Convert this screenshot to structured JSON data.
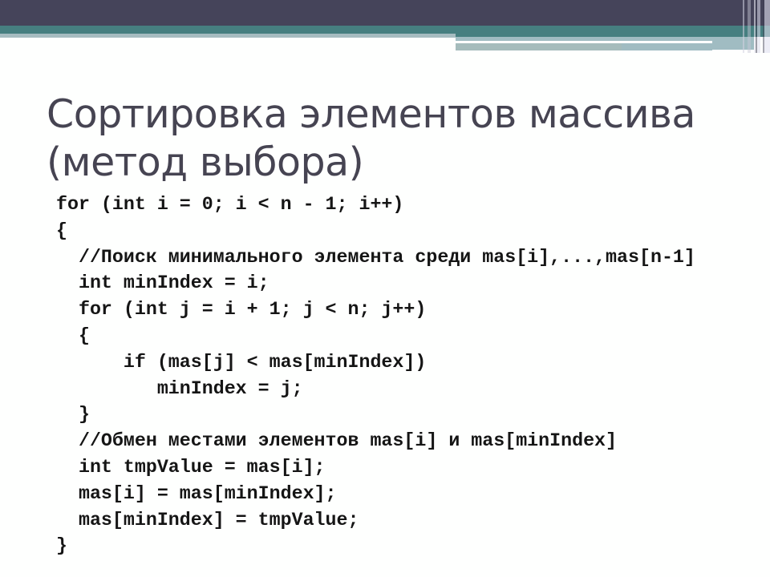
{
  "slide": {
    "title": "Сортировка элементов массива (метод выбора)",
    "code_lines": [
      {
        "indent": 0,
        "text": "for (int i = 0; i < n - 1; i++)"
      },
      {
        "indent": 0,
        "text": "{"
      },
      {
        "indent": 2,
        "text": "//Поиск минимального элемента среди mas[i],...,mas[n-1]"
      },
      {
        "indent": 2,
        "text": "int minIndex = i;"
      },
      {
        "indent": 2,
        "text": "for (int j = i + 1; j < n; j++)"
      },
      {
        "indent": 2,
        "text": "{"
      },
      {
        "indent": 6,
        "text": "if (mas[j] < mas[minIndex])"
      },
      {
        "indent": 9,
        "text": "minIndex = j;"
      },
      {
        "indent": 2,
        "text": "}"
      },
      {
        "indent": 2,
        "text": "//Обмен местами элементов mas[i] и mas[minIndex]"
      },
      {
        "indent": 2,
        "text": "int tmpValue = mas[i];"
      },
      {
        "indent": 2,
        "text": "mas[i] = mas[minIndex];"
      },
      {
        "indent": 2,
        "text": "mas[minIndex] = tmpValue;"
      },
      {
        "indent": 0,
        "text": "}"
      }
    ]
  },
  "theme": {
    "header_navy": "#45445a",
    "header_teal": "#467f80",
    "header_gray": "#a6bcc0",
    "title_color": "#464452",
    "code_color": "#151515"
  }
}
